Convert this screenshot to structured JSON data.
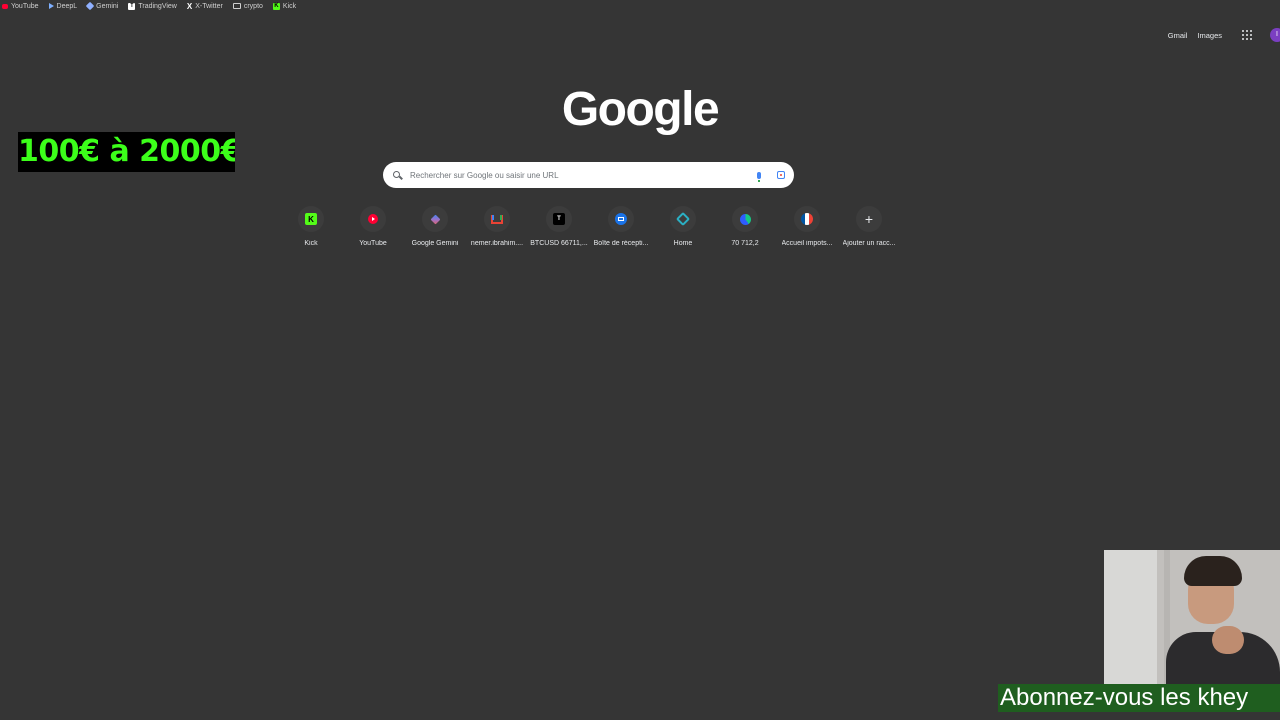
{
  "bookmarks": [
    {
      "label": "YouTube",
      "icon": "youtube-icon"
    },
    {
      "label": "DeepL",
      "icon": "deepl-icon"
    },
    {
      "label": "Gemini",
      "icon": "gemini-icon"
    },
    {
      "label": "TradingView",
      "icon": "tradingview-icon"
    },
    {
      "label": "X-Twitter",
      "icon": "x-icon"
    },
    {
      "label": "crypto",
      "icon": "folder-icon"
    },
    {
      "label": "Kick",
      "icon": "kick-icon"
    }
  ],
  "header": {
    "gmail": "Gmail",
    "images": "Images",
    "avatar_initial": "I"
  },
  "promo": {
    "text": "100€ à 2000€",
    "text_color": "#3cff1a",
    "background": "#000000"
  },
  "logo": {
    "text": "Google"
  },
  "search": {
    "placeholder": "Rechercher sur Google ou saisir une URL",
    "value": ""
  },
  "shortcuts": [
    {
      "label": "Kick",
      "icon": "kick-icon"
    },
    {
      "label": "YouTube",
      "icon": "youtube-icon"
    },
    {
      "label": "Google Gemini",
      "icon": "gemini-icon"
    },
    {
      "label": "nemer.ibrahim....",
      "icon": "gmail-icon"
    },
    {
      "label": "BTCUSD 66711,...",
      "icon": "tradingview-icon"
    },
    {
      "label": "Boîte de récepti...",
      "icon": "mail-icon"
    },
    {
      "label": "Home",
      "icon": "home-icon"
    },
    {
      "label": "70 712,2",
      "icon": "coin-icon"
    },
    {
      "label": "Accueil impots...",
      "icon": "impots-icon"
    },
    {
      "label": "Ajouter un racc...",
      "icon": "plus-icon"
    }
  ],
  "subscribe": {
    "text": "Abonnez-vous les khey"
  },
  "colors": {
    "background": "#353535",
    "search_bg": "#ffffff",
    "subscribe_bg": "#1f5e1f"
  }
}
